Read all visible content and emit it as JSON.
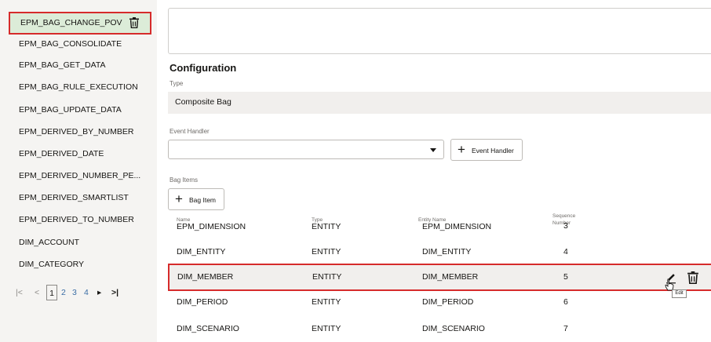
{
  "sidebar": {
    "items": [
      {
        "label": "EPM_BAG_CHANGE_POV"
      },
      {
        "label": "EPM_BAG_CONSOLIDATE"
      },
      {
        "label": "EPM_BAG_GET_DATA"
      },
      {
        "label": "EPM_BAG_RULE_EXECUTION"
      },
      {
        "label": "EPM_BAG_UPDATE_DATA"
      },
      {
        "label": "EPM_DERIVED_BY_NUMBER"
      },
      {
        "label": "EPM_DERIVED_DATE"
      },
      {
        "label": "EPM_DERIVED_NUMBER_PE..."
      },
      {
        "label": "EPM_DERIVED_SMARTLIST"
      },
      {
        "label": "EPM_DERIVED_TO_NUMBER"
      },
      {
        "label": "DIM_ACCOUNT"
      },
      {
        "label": "DIM_CATEGORY"
      }
    ],
    "selected_index": 0,
    "pager": {
      "first": "|<",
      "prev": "<",
      "pages": [
        "1",
        "2",
        "3",
        "4"
      ],
      "current": "1",
      "next": "▸",
      "last": ">|"
    }
  },
  "config": {
    "title": "Configuration",
    "type_label": "Type",
    "type_value": "Composite Bag",
    "event_handler_label": "Event Handler",
    "event_handler_value": "",
    "add_event_handler_label": "Event Handler",
    "bag_items_label": "Bag Items",
    "add_bag_item_label": "Bag Item"
  },
  "table": {
    "columns": [
      {
        "small": "Name",
        "big": "EPM_DIMENSION"
      },
      {
        "small": "Type",
        "big": "ENTITY"
      },
      {
        "small": "Entity Name",
        "big": "EPM_DIMENSION"
      },
      {
        "small": "Sequence",
        "small2": "Number",
        "big": "3"
      }
    ],
    "rows": [
      {
        "name": "DIM_ENTITY",
        "type": "ENTITY",
        "entity": "DIM_ENTITY",
        "seq": "4"
      },
      {
        "name": "DIM_MEMBER",
        "type": "ENTITY",
        "entity": "DIM_MEMBER",
        "seq": "5"
      },
      {
        "name": "DIM_PERIOD",
        "type": "ENTITY",
        "entity": "DIM_PERIOD",
        "seq": "6"
      },
      {
        "name": "DIM_SCENARIO",
        "type": "ENTITY",
        "entity": "DIM_SCENARIO",
        "seq": "7"
      }
    ],
    "highlighted_row": 1
  },
  "tooltip": {
    "text": "Edit"
  },
  "icons": {
    "trash": "trash-icon",
    "pencil": "pencil-icon",
    "caret": "chevron-down-icon",
    "plus": "plus-icon"
  },
  "colors": {
    "highlight_border": "#d62b2b",
    "selected_bg": "#dcecd8",
    "sidebar_bg": "#f5f4f2",
    "link": "#3b6ea5"
  }
}
